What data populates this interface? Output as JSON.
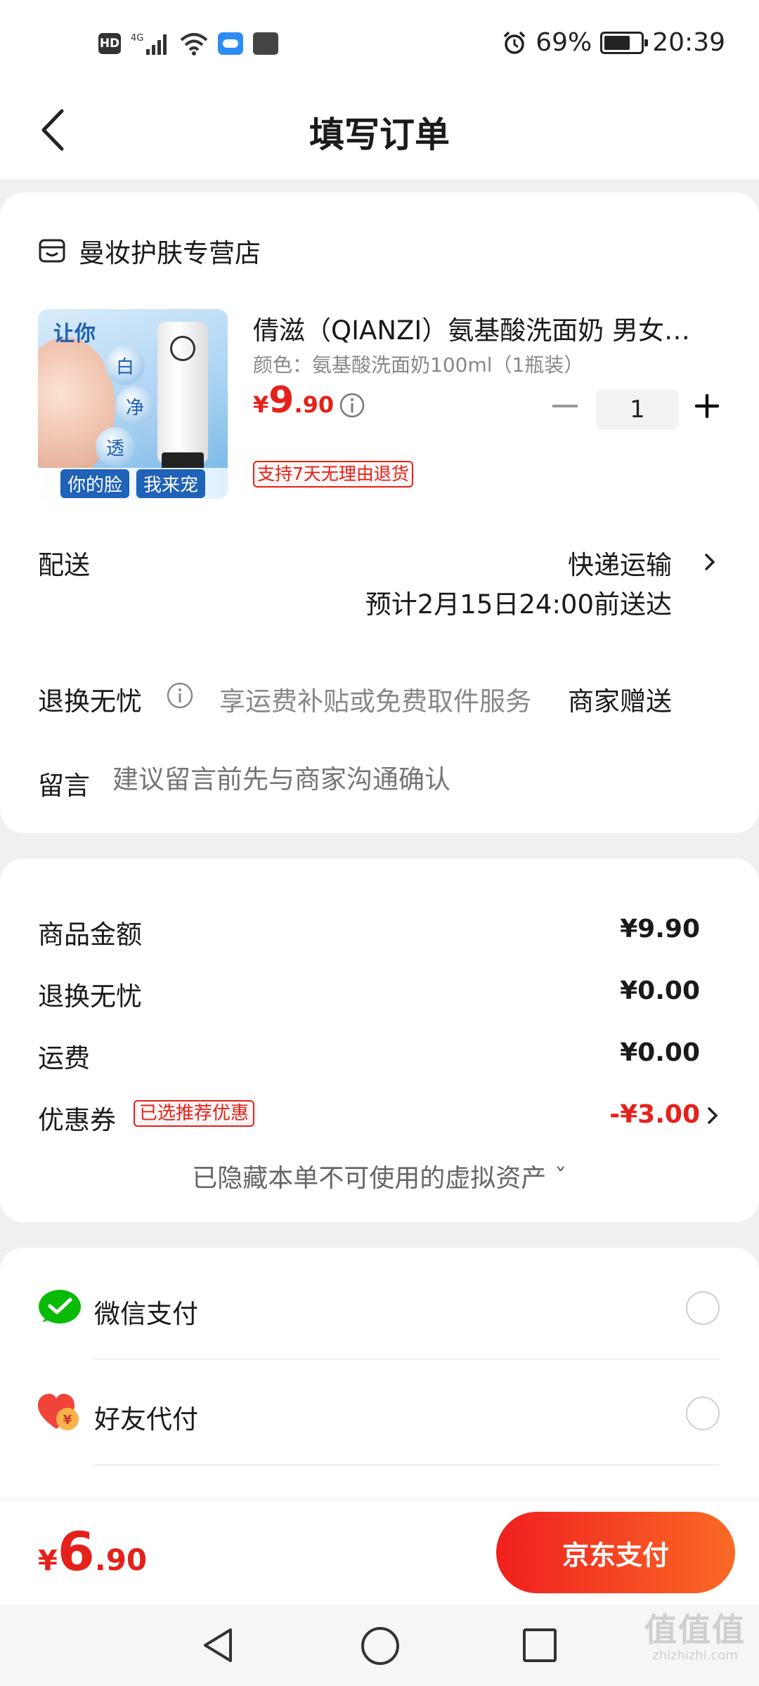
{
  "status_bar": {
    "hd": "HD",
    "network": "4G",
    "battery_percent": "69%",
    "time": "20:39",
    "icons": [
      "hd-icon",
      "signal-icon",
      "wifi-icon",
      "cloud-icon",
      "mail-icon",
      "alarm-icon",
      "battery-icon"
    ]
  },
  "header": {
    "title": "填写订单",
    "back_icon": "chevron-left-icon"
  },
  "store": {
    "name": "曼妆护肤专营店",
    "icon": "store-icon"
  },
  "product": {
    "title": "倩滋（QIANZI）氨基酸洗面奶 男女…",
    "spec": "颜色：氨基酸洗面奶100ml（1瓶装）",
    "price_symbol": "¥",
    "price_int": "9",
    "price_dec": ".90",
    "quantity": "1",
    "return_policy_badge": "支持7天无理由退货",
    "image_text": {
      "tag": "让你",
      "bubbles": [
        "白",
        "净",
        "透"
      ],
      "banner_left": "你的脸",
      "banner_right": "我来宠"
    }
  },
  "delivery": {
    "label": "配送",
    "method": "快递运输",
    "eta": "预计2月15日24:00前送达"
  },
  "worry_free": {
    "label": "退换无忧",
    "description": "享运费补贴或免费取件服务",
    "gift": "商家赠送"
  },
  "message": {
    "label": "留言",
    "placeholder": "建议留言前先与商家沟通确认"
  },
  "summary": {
    "goods_amount_label": "商品金额",
    "goods_amount": "¥9.90",
    "worry_free_label": "退换无忧",
    "worry_free_amount": "¥0.00",
    "shipping_label": "运费",
    "shipping_amount": "¥0.00",
    "coupon_label": "优惠券",
    "coupon_badge": "已选推荐优惠",
    "coupon_amount": "-¥3.00",
    "hidden_assets": "已隐藏本单不可使用的虚拟资产 ˇ"
  },
  "payment_methods": [
    {
      "label": "微信支付",
      "icon": "wechat-pay-icon"
    },
    {
      "label": "好友代付",
      "icon": "friend-pay-icon"
    }
  ],
  "checkout": {
    "total_symbol": "¥",
    "total_int": "6",
    "total_dec": ".90",
    "pay_button": "京东支付"
  },
  "watermark": {
    "mark": "值值值",
    "url": "zhizhizhi.com"
  },
  "colors": {
    "accent_red": "#e4211a",
    "wechat_green": "#09bb07",
    "pay_gradient_start": "#f01f1f",
    "pay_gradient_end": "#fa6a26"
  }
}
